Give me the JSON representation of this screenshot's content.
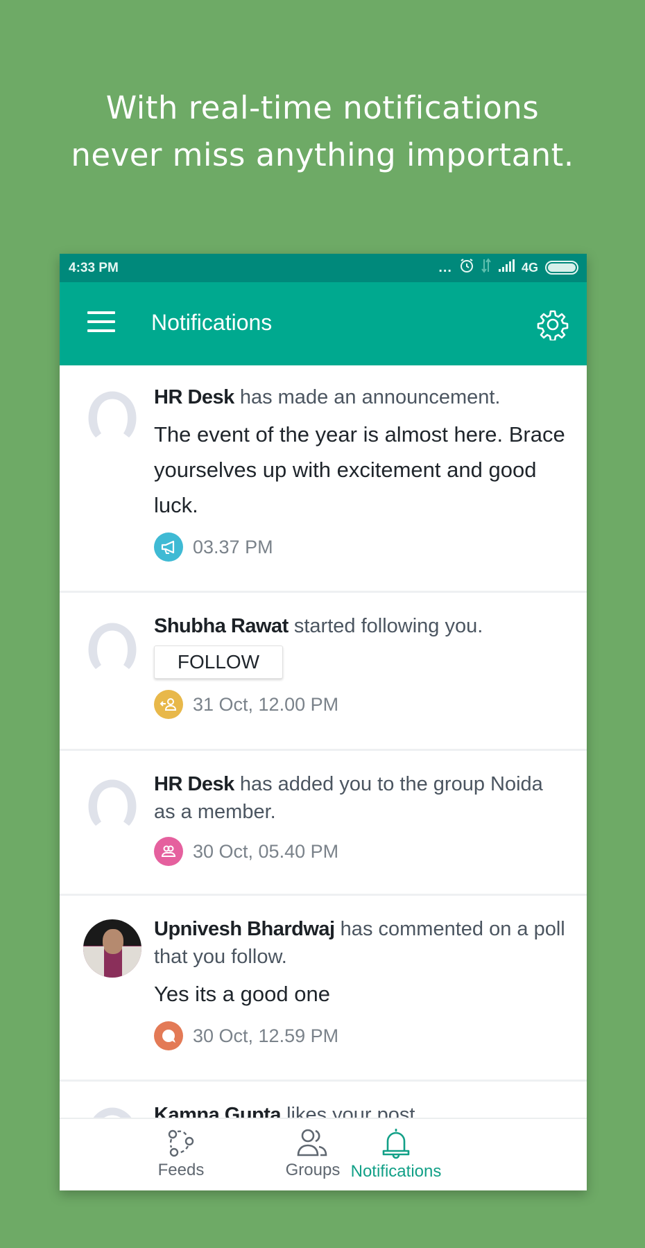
{
  "promo": {
    "line1": "With real-time notifications",
    "line2": "never miss anything important."
  },
  "status_bar": {
    "time": "4:33 PM",
    "overflow": "...",
    "network": "4G",
    "icons": [
      "alarm-icon",
      "data-arrows-icon",
      "signal-icon",
      "battery-icon"
    ]
  },
  "app_bar": {
    "title": "Notifications",
    "menu_icon": "hamburger-menu-icon",
    "settings_icon": "gear-icon"
  },
  "colors": {
    "background": "#6eaa66",
    "status_bar": "#00897b",
    "app_bar": "#00a98f",
    "active_tab": "#12a087",
    "announcement": "#3fbad4",
    "follow": "#e8b84a",
    "group": "#e5609e",
    "comment": "#e37a56"
  },
  "notifications": [
    {
      "actor": "HR Desk",
      "action": " has made an announcement.",
      "body": "The event of the year is almost here. Brace yourselves up with excitement and good luck.",
      "time": "03.37 PM",
      "type": "announcement",
      "type_icon": "megaphone-icon",
      "avatar": "placeholder"
    },
    {
      "actor": "Shubha Rawat",
      "action": " started following you.",
      "button": "FOLLOW",
      "time": "31 Oct, 12.00 PM",
      "type": "follow",
      "type_icon": "add-follower-icon",
      "avatar": "placeholder"
    },
    {
      "actor": "HR Desk",
      "action": " has added you to the group Noida as a member.",
      "time": "30 Oct, 05.40 PM",
      "type": "group",
      "type_icon": "group-icon",
      "avatar": "placeholder"
    },
    {
      "actor": "Upnivesh Bhardwaj",
      "action": " has commented on a poll that you follow.",
      "body": "Yes its a good one",
      "time": "30 Oct, 12.59 PM",
      "type": "comment",
      "type_icon": "comment-bubble-icon",
      "avatar": "photo"
    },
    {
      "actor": "Kamna Gupta",
      "action": " likes your post",
      "avatar": "placeholder"
    }
  ],
  "bottom_nav": [
    {
      "label": "Feeds",
      "icon": "feeds-icon",
      "active": false
    },
    {
      "label": "Groups",
      "icon": "groups-icon",
      "active": false
    },
    {
      "label": "Notifications",
      "icon": "bell-icon",
      "active": true
    }
  ]
}
